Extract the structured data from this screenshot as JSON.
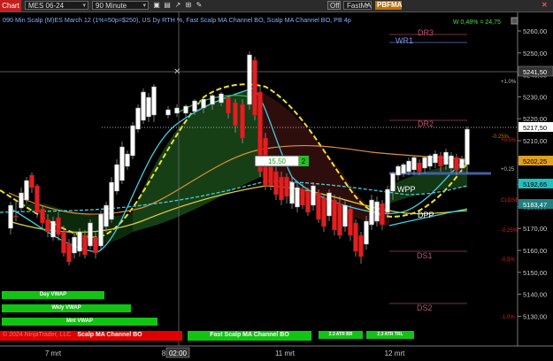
{
  "toolbar": {
    "chart_tab": "Chart",
    "instrument": "MES 06-24",
    "interval": "90 Minute",
    "btn_1": "▣",
    "btn_2": "▤",
    "btn_3": "↗",
    "btn_4": "⊞",
    "btn_5": "✎",
    "off_label": "Off",
    "strategy_select": "FastMA",
    "pbfma_label": "PBFMA",
    "close_glyph": "✕"
  },
  "chart": {
    "header": "090 Min Scalp (M)ES March 12 (1%=50p=$250), US Dy RTH %, Fast Scalp MA Channel BO, Scalp MA Channel BO, PB 4p",
    "wl_label": "W 0,48% = 24,75",
    "copyright": "© 2024 NinjaTrader, LLC",
    "channel_label": "Scalp MA Channel BO",
    "fast_channel_label": "Fast Scalp MA Channel BO",
    "marker_value": "15,50",
    "marker_badge": "2",
    "time_cursor": "02:00"
  },
  "levels": {
    "dr3": "DR3",
    "wr1": "WR1",
    "dr2": "DR2",
    "wpp": "WPP",
    "dpp": "DPP",
    "ds1": "DS1",
    "ds2": "DS2",
    "close": "CLOSE"
  },
  "pct_labels": {
    "p1": "+1.0%",
    "p05": "+0.5%",
    "p025": "+0.25",
    "m025": "-0.25%",
    "m05": "-0.5%",
    "m1": "-1.0%",
    "neg_top": "-0.25%"
  },
  "price_axis": {
    "ticks": [
      "5260,00",
      "5250,00",
      "5240,00",
      "5230,00",
      "5220,00",
      "5210,00",
      "5200,00",
      "5190,00",
      "5180,00",
      "5170,00",
      "5160,00",
      "5150,00",
      "5140,00",
      "5130,00"
    ],
    "crosshair_price": "5241,50",
    "last_price": "5217,50",
    "tag_1": "5202,25",
    "tag_2": "5192,65",
    "tag_3": "5183,47"
  },
  "time_axis": {
    "labels": [
      "7 mrt",
      "8",
      "11 mrt",
      "12 mrt"
    ]
  },
  "vwap_buttons": {
    "day": "Day VWAP",
    "wkly": "Wkly VWAP",
    "mnt": "Mnt VWAP"
  },
  "bottom_small": {
    "b1": "2.3 ATR BR",
    "b2": "2.3 ATR TRL"
  },
  "colors": {
    "background": "#000000",
    "bull": "#ffffff",
    "bear": "#e02020",
    "fast_ma": "#40d0e0",
    "slow_ma": "#f0e030",
    "orange_ma": "#e09030",
    "cloud_green": "#1f5a1f",
    "cloud_red": "#3a1010",
    "tag_orange": "#e0a020",
    "tag_cyan": "#20c0c0"
  }
}
